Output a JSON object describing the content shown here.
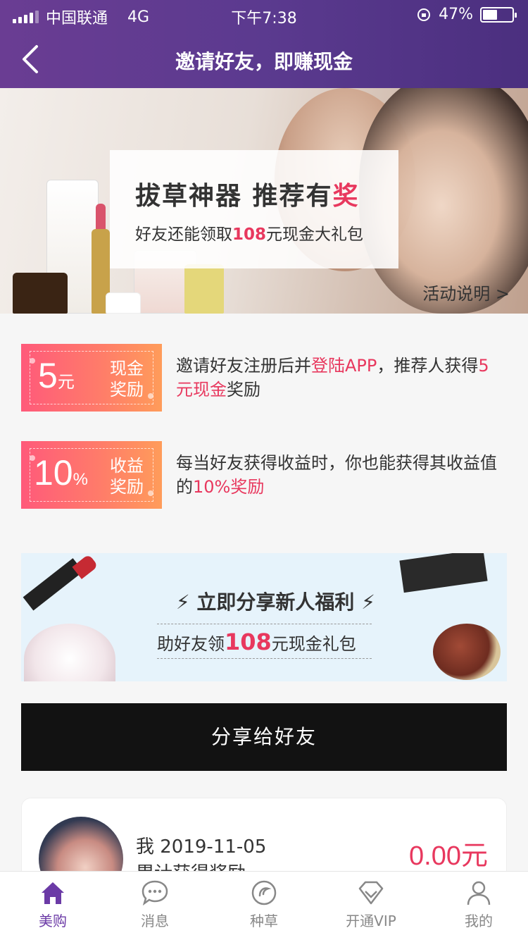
{
  "status": {
    "carrier": "中国联通",
    "network": "4G",
    "time": "下午7:38",
    "battery": "47%"
  },
  "nav": {
    "title": "邀请好友，即赚现金"
  },
  "banner": {
    "headline_main": "拔草神器  推荐有",
    "headline_highlight": "奖",
    "subtitle_pre": "好友还能领取",
    "subtitle_num": "108",
    "subtitle_post": "元现金大礼包",
    "activity_link": "活动说明 >"
  },
  "rewards": [
    {
      "coupon_value": "5",
      "coupon_unit": "元",
      "coupon_label": "现金奖励",
      "desc_pre": "邀请好友注册后并",
      "desc_red1": "登陆APP",
      "desc_mid": "，推荐人获得",
      "desc_red2": "5元现金",
      "desc_post": "奖励"
    },
    {
      "coupon_value": "10",
      "coupon_unit": "%",
      "coupon_label": "收益奖励",
      "desc_pre": "每当好友获得收益时，你也能获得其收益值的",
      "desc_red1": "10%奖励"
    }
  ],
  "share_banner": {
    "title": "立即分享新人福利",
    "line_pre": "助好友领",
    "line_num": "108",
    "line_post": "元现金礼包"
  },
  "share_button": "分享给好友",
  "record": {
    "line1": "我 2019-11-05",
    "line2": "累计获得奖励",
    "amount": "0.00元"
  },
  "tabs": [
    {
      "label": "美购",
      "icon": "home-icon",
      "active": true
    },
    {
      "label": "消息",
      "icon": "chat-icon",
      "active": false
    },
    {
      "label": "种草",
      "icon": "discover-icon",
      "active": false
    },
    {
      "label": "开通VIP",
      "icon": "diamond-icon",
      "active": false
    },
    {
      "label": "我的",
      "icon": "user-icon",
      "active": false
    }
  ],
  "colors": {
    "accent": "#6b3aa6",
    "highlight": "#e8385e",
    "nav_bg": "#5b3a8f"
  }
}
